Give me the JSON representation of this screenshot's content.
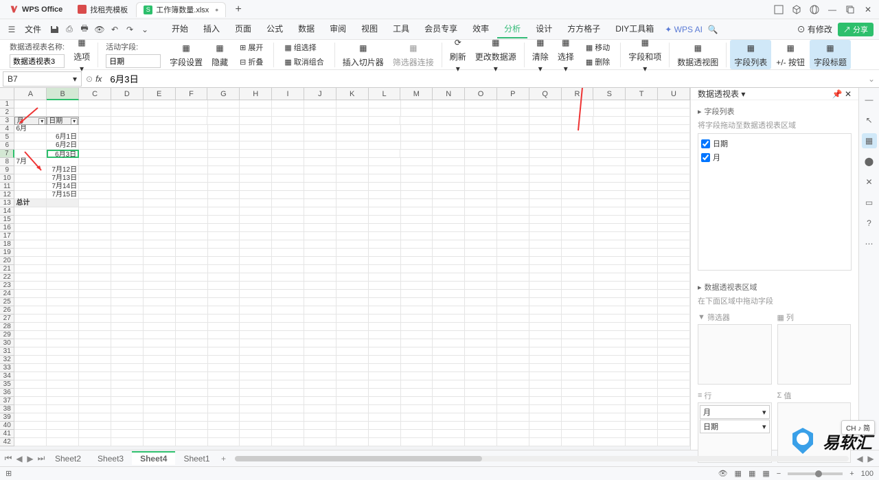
{
  "titleBar": {
    "wps": "WPS Office",
    "tabs": [
      {
        "label": "找租壳模板",
        "icon": "#d94b4b"
      },
      {
        "label": "工作簿数量.xlsx",
        "icon": "#2dbf6c"
      }
    ]
  },
  "menu": {
    "file": "文件",
    "tabs": [
      "开始",
      "插入",
      "页面",
      "公式",
      "数据",
      "审阅",
      "视图",
      "工具",
      "会员专享",
      "效率",
      "分析",
      "设计",
      "方方格子",
      "DIY工具箱"
    ],
    "active": 10,
    "wpsai": "WPS AI",
    "changes": "有修改",
    "share": "分享"
  },
  "ribbon": {
    "ptNameLabel": "数据透视表名称:",
    "ptName": "数据透视表3",
    "options": "选项",
    "activeFieldLabel": "活动字段:",
    "activeField": "日期",
    "fieldSettings": "字段设置",
    "hide": "隐藏",
    "expand": "展开",
    "collapse": "折叠",
    "group": "组选择",
    "ungroup": "取消组合",
    "slicer": "插入切片器",
    "filterConn": "筛选器连接",
    "refresh": "刷新",
    "changeSource": "更改数据源",
    "clear": "清除",
    "select": "选择",
    "move": "移动",
    "delete": "删除",
    "fieldsItems": "字段和项",
    "pivotChart": "数据透视图",
    "fieldListBtn": "字段列表",
    "pmBtn": "+/- 按钮",
    "fieldHeaders": "字段标题"
  },
  "formulaBar": {
    "nameBox": "B7",
    "fx": "6月3日"
  },
  "cols": [
    "A",
    "B",
    "C",
    "D",
    "E",
    "F",
    "G",
    "H",
    "I",
    "J",
    "K",
    "L",
    "M",
    "N",
    "O",
    "P",
    "Q",
    "R",
    "S",
    "T",
    "U"
  ],
  "grid": {
    "header": {
      "month": "月",
      "date": "日期"
    },
    "rows": [
      {
        "r": 4,
        "a": "6月"
      },
      {
        "r": 5,
        "b": "6月1日"
      },
      {
        "r": 6,
        "b": "6月2日"
      },
      {
        "r": 7,
        "b": "6月3日"
      },
      {
        "r": 8,
        "a": "7月"
      },
      {
        "r": 9,
        "b": "7月12日"
      },
      {
        "r": 10,
        "b": "7月13日"
      },
      {
        "r": 11,
        "b": "7月14日"
      },
      {
        "r": 12,
        "b": "7月15日"
      },
      {
        "r": 13,
        "a": "总计"
      }
    ]
  },
  "pane": {
    "title": "数据透视表",
    "fieldListTitle": "字段列表",
    "dragHint": "将字段拖动至数据透视表区域",
    "fields": [
      {
        "name": "日期",
        "checked": true
      },
      {
        "name": "月",
        "checked": true
      }
    ],
    "areaTitle": "数据透视表区域",
    "areaHint": "在下面区域中拖动字段",
    "filter": "筛选器",
    "column": "列",
    "row": "行",
    "value": "值",
    "rowItems": [
      "月",
      "日期"
    ]
  },
  "sheets": [
    "Sheet2",
    "Sheet3",
    "Sheet4",
    "Sheet1"
  ],
  "activeSheet": 2,
  "status": {
    "zoom": "100"
  },
  "badge": "CH ♪ 简",
  "brand": "易软汇"
}
